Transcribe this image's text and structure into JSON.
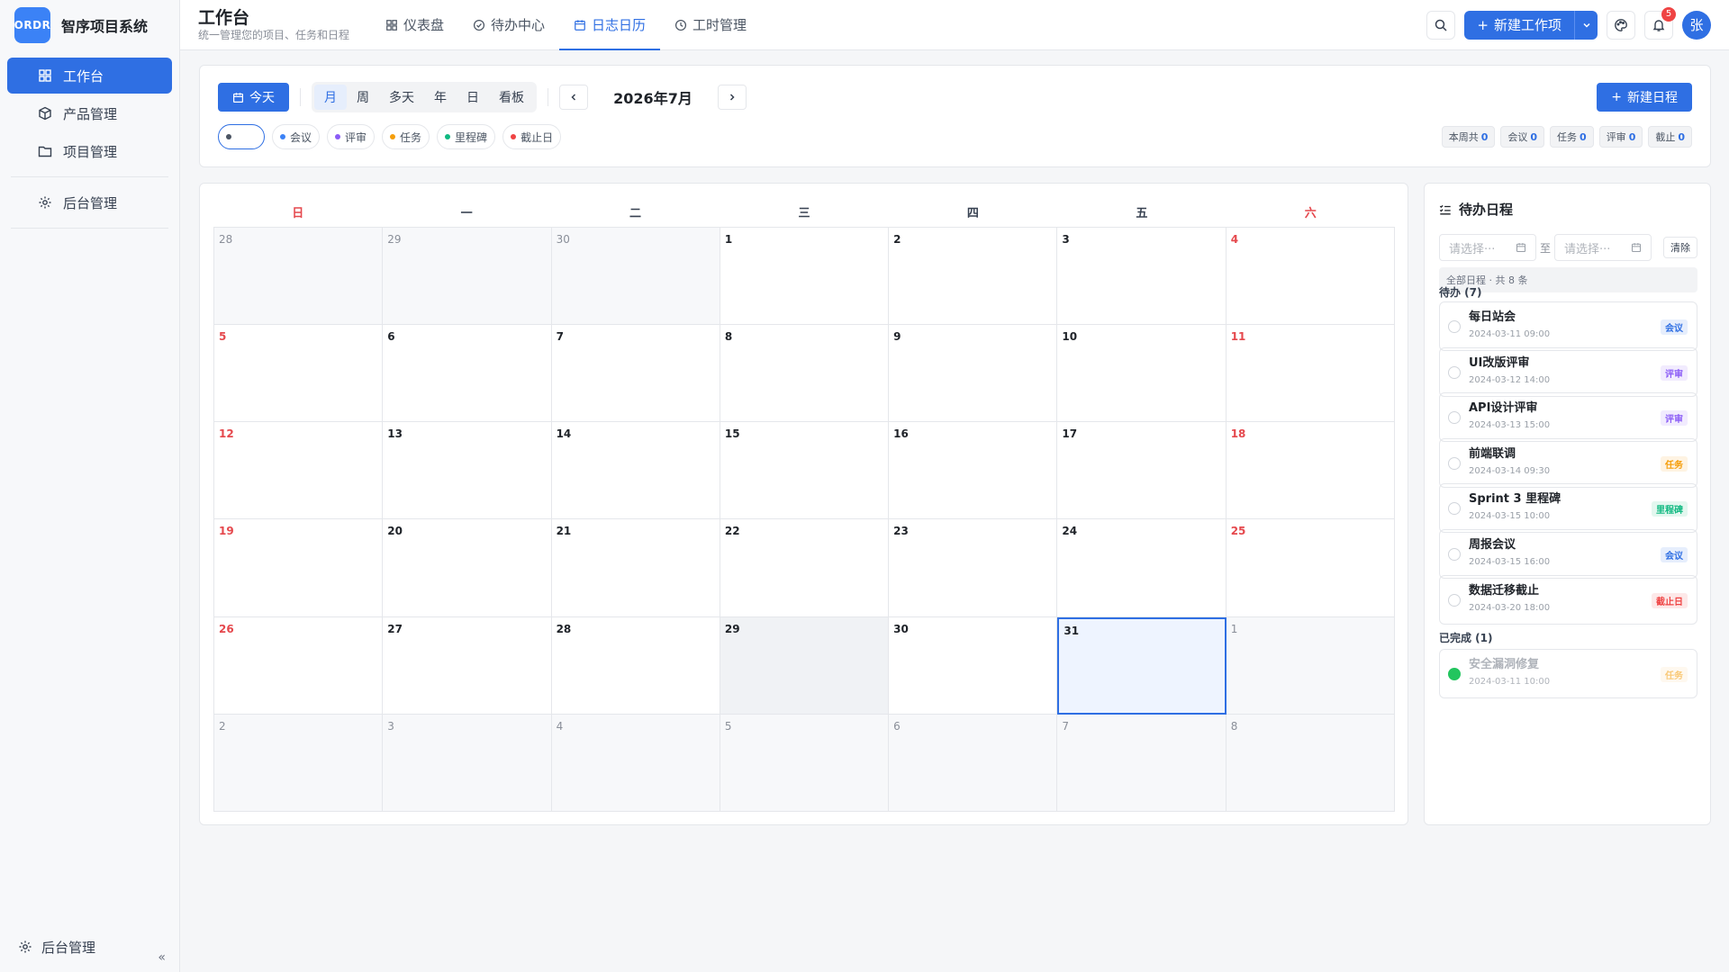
{
  "brand": {
    "logo_text": "ORDR",
    "name": "智序项目系统"
  },
  "sidebar": {
    "items": [
      {
        "label": "工作台",
        "icon": "grid-icon",
        "active": true
      },
      {
        "label": "产品管理",
        "icon": "box-icon",
        "active": false
      },
      {
        "label": "项目管理",
        "icon": "folder-icon",
        "active": false
      }
    ],
    "admin": {
      "label": "后台管理",
      "icon": "gear-icon"
    },
    "footer": {
      "label": "后台管理",
      "collapse": "«"
    }
  },
  "header": {
    "title": "工作台",
    "subtitle": "统一管理您的项目、任务和日程",
    "tabs": [
      {
        "label": "仪表盘",
        "icon": "grid-icon",
        "active": false
      },
      {
        "label": "待办中心",
        "icon": "check-circle-icon",
        "active": false
      },
      {
        "label": "日志日历",
        "icon": "calendar-icon",
        "active": true
      },
      {
        "label": "工时管理",
        "icon": "clock-icon",
        "active": false
      }
    ],
    "new_work_item": "新建工作项",
    "notification_count": "5",
    "avatar": "张"
  },
  "toolbar": {
    "today": "今天",
    "views": [
      {
        "label": "月",
        "active": true
      },
      {
        "label": "周",
        "active": false
      },
      {
        "label": "多天",
        "active": false
      },
      {
        "label": "年",
        "active": false
      },
      {
        "label": "日",
        "active": false
      },
      {
        "label": "看板",
        "active": false
      }
    ],
    "month_label": "2026年7月",
    "new_schedule": "新建日程",
    "filters": [
      {
        "label": "会议",
        "color": "#3b82f6"
      },
      {
        "label": "评审",
        "color": "#8b5cf6"
      },
      {
        "label": "任务",
        "color": "#f59e0b"
      },
      {
        "label": "里程碑",
        "color": "#10b981"
      },
      {
        "label": "截止日",
        "color": "#ef4444"
      }
    ],
    "stats": [
      {
        "label": "本周共",
        "value": "0"
      },
      {
        "label": "会议",
        "value": "0"
      },
      {
        "label": "任务",
        "value": "0"
      },
      {
        "label": "评审",
        "value": "0"
      },
      {
        "label": "截止",
        "value": "0"
      }
    ]
  },
  "calendar": {
    "weekdays": [
      "日",
      "一",
      "二",
      "三",
      "四",
      "五",
      "六"
    ],
    "weeks": [
      [
        {
          "d": "28",
          "o": true
        },
        {
          "d": "29",
          "o": true
        },
        {
          "d": "30",
          "o": true
        },
        {
          "d": "1"
        },
        {
          "d": "2"
        },
        {
          "d": "3"
        },
        {
          "d": "4"
        }
      ],
      [
        {
          "d": "5"
        },
        {
          "d": "6"
        },
        {
          "d": "7"
        },
        {
          "d": "8"
        },
        {
          "d": "9"
        },
        {
          "d": "10"
        },
        {
          "d": "11"
        }
      ],
      [
        {
          "d": "12"
        },
        {
          "d": "13"
        },
        {
          "d": "14"
        },
        {
          "d": "15"
        },
        {
          "d": "16"
        },
        {
          "d": "17"
        },
        {
          "d": "18"
        }
      ],
      [
        {
          "d": "19"
        },
        {
          "d": "20"
        },
        {
          "d": "21"
        },
        {
          "d": "22"
        },
        {
          "d": "23"
        },
        {
          "d": "24"
        },
        {
          "d": "25"
        }
      ],
      [
        {
          "d": "26"
        },
        {
          "d": "27"
        },
        {
          "d": "28"
        },
        {
          "d": "29",
          "hl": true
        },
        {
          "d": "30"
        },
        {
          "d": "31",
          "sel": true
        },
        {
          "d": "1",
          "o": true
        }
      ],
      [
        {
          "d": "2",
          "o": true
        },
        {
          "d": "3",
          "o": true
        },
        {
          "d": "4",
          "o": true
        },
        {
          "d": "5",
          "o": true
        },
        {
          "d": "6",
          "o": true
        },
        {
          "d": "7",
          "o": true
        },
        {
          "d": "8",
          "o": true
        }
      ]
    ]
  },
  "agenda": {
    "title": "待办日程",
    "start_placeholder": "请选择···",
    "end_placeholder": "请选择···",
    "range_sep": "至",
    "clear": "清除",
    "scope": "全部日程 · 共 8 条",
    "pending_label": "待办 (7)",
    "done_label": "已完成 (1)",
    "pending": [
      {
        "name": "每日站会",
        "time": "2024-03-11 09:00",
        "tag": "会议",
        "tag_color": "#2f6fe3",
        "tag_bg": "#e6eefc"
      },
      {
        "name": "UI改版评审",
        "time": "2024-03-12 14:00",
        "tag": "评审",
        "tag_color": "#8b5cf6",
        "tag_bg": "#f1ebfe"
      },
      {
        "name": "API设计评审",
        "time": "2024-03-13 15:00",
        "tag": "评审",
        "tag_color": "#8b5cf6",
        "tag_bg": "#f1ebfe"
      },
      {
        "name": "前端联调",
        "time": "2024-03-14 09:30",
        "tag": "任务",
        "tag_color": "#f59e0b",
        "tag_bg": "#fef3e2"
      },
      {
        "name": "Sprint 3 里程碑",
        "time": "2024-03-15 10:00",
        "tag": "里程碑",
        "tag_color": "#10b981",
        "tag_bg": "#e3f7ef"
      },
      {
        "name": "周报会议",
        "time": "2024-03-15 16:00",
        "tag": "会议",
        "tag_color": "#2f6fe3",
        "tag_bg": "#e6eefc"
      },
      {
        "name": "数据迁移截止",
        "time": "2024-03-20 18:00",
        "tag": "截止日",
        "tag_color": "#ef4444",
        "tag_bg": "#fde8e8"
      }
    ],
    "done": [
      {
        "name": "安全漏洞修复",
        "time": "2024-03-11 10:00",
        "tag": "任务",
        "tag_color": "#f59e0b",
        "tag_bg": "#fef3e2"
      }
    ]
  }
}
